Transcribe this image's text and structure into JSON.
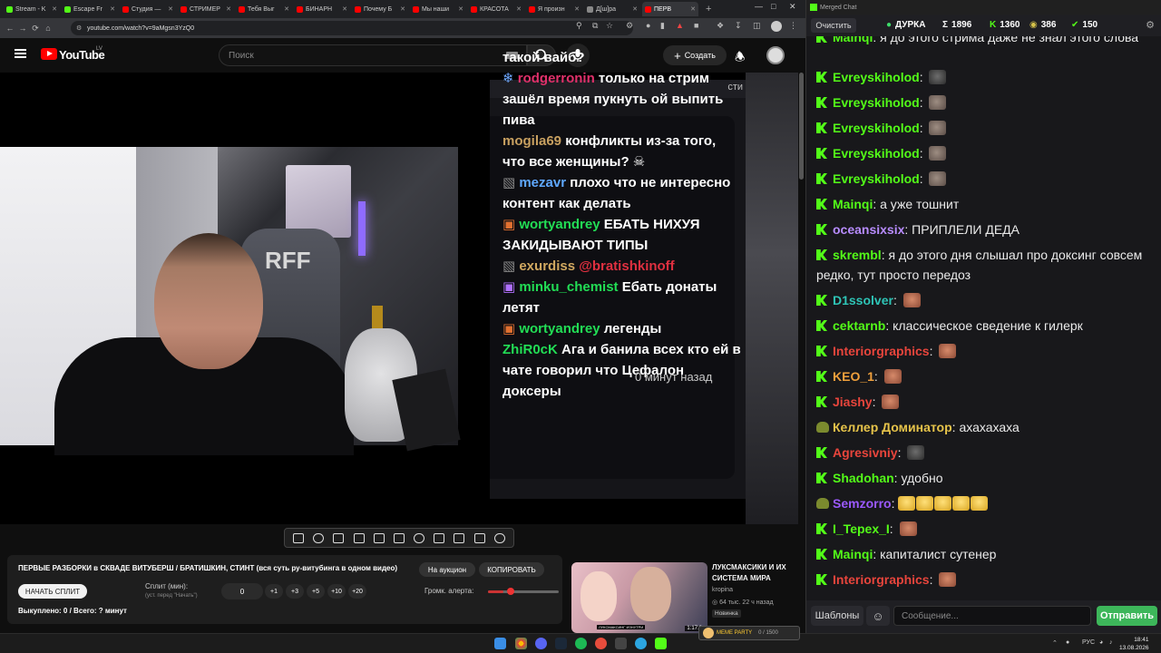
{
  "browser": {
    "tabs": [
      {
        "label": "Stream - K",
        "color": "#53fc18"
      },
      {
        "label": "Escape Fr",
        "color": "#53fc18"
      },
      {
        "label": "Студия —",
        "color": "#ff0000"
      },
      {
        "label": "СТРИМЕР",
        "color": "#ff0000"
      },
      {
        "label": "Тебя Выг",
        "color": "#ff0000"
      },
      {
        "label": "БИНАРН",
        "color": "#ff0000"
      },
      {
        "label": "Почему Б",
        "color": "#ff0000"
      },
      {
        "label": "Мы наши",
        "color": "#ff0000"
      },
      {
        "label": "КРАСОТА",
        "color": "#ff0000"
      },
      {
        "label": "Я произн",
        "color": "#ff0000"
      },
      {
        "label": "Д[ш]ра",
        "color": "#888888"
      },
      {
        "label": "ПЕРВ",
        "color": "#ff0000",
        "active": true
      }
    ],
    "url": "youtube.com/watch?v=9aMgsn3YzQ0"
  },
  "youtube": {
    "logo_word": "YouTube",
    "country_code": "LV",
    "search_placeholder": "Поиск",
    "create_label": "Создать"
  },
  "overlay_chat": {
    "header_fragment": "сти",
    "lines": [
      [
        {
          "t": "такой вайб?",
          "c": "#ffffff"
        }
      ],
      [
        {
          "t": "❄ ",
          "c": "#6ea8ff"
        },
        {
          "t": "rodgerronin",
          "c": "#e0306a"
        },
        {
          "t": " только на стрим",
          "c": "#ffffff"
        }
      ],
      [
        {
          "t": "зашёл время пукнуть ой выпить",
          "c": "#ffffff"
        }
      ],
      [
        {
          "t": "пива",
          "c": "#ffffff"
        }
      ],
      [
        {
          "t": "mogila69",
          "c": "#c8a060"
        },
        {
          "t": " конфликты из-за того,",
          "c": "#ffffff"
        }
      ],
      [
        {
          "t": "что все женщины? ☠",
          "c": "#ffffff"
        }
      ],
      [
        {
          "t": "▧ ",
          "c": "#888888"
        },
        {
          "t": "mezavr",
          "c": "#5fa8ff"
        },
        {
          "t": " плохо что не интересно",
          "c": "#ffffff"
        }
      ],
      [
        {
          "t": "контент как делать",
          "c": "#ffffff"
        }
      ],
      [
        {
          "t": "▣ ",
          "c": "#e07030"
        },
        {
          "t": "wortyandrey",
          "c": "#22dd55"
        },
        {
          "t": " ЕБАТЬ НИХУЯ",
          "c": "#ffffff"
        }
      ],
      [
        {
          "t": "ЗАКИДЫВАЮТ ТИПЫ",
          "c": "#ffffff"
        }
      ],
      [
        {
          "t": "▧ ",
          "c": "#888888"
        },
        {
          "t": "exurdiss",
          "c": "#d0a860"
        },
        {
          "t": " @bratishkinoff",
          "c": "#e03040"
        }
      ],
      [
        {
          "t": "▣ ",
          "c": "#b070ff"
        },
        {
          "t": "minku_chemist",
          "c": "#22dd55"
        },
        {
          "t": " Ебать донаты",
          "c": "#ffffff"
        }
      ],
      [
        {
          "t": "летят",
          "c": "#ffffff"
        }
      ],
      [
        {
          "t": "▣ ",
          "c": "#e07030"
        },
        {
          "t": "wortyandrey",
          "c": "#22dd55"
        },
        {
          "t": " легенды",
          "c": "#ffffff"
        }
      ],
      [
        {
          "t": "ZhiR0cK",
          "c": "#22dd55"
        },
        {
          "t": " Ага и банила всех кто ей в",
          "c": "#ffffff"
        }
      ],
      [
        {
          "t": "чате говорил что Цефалон",
          "c": "#ffffff"
        }
      ],
      [
        {
          "t": "доксеры",
          "c": "#ffffff"
        }
      ]
    ],
    "timestamp": "0 минут назад"
  },
  "extension": {
    "title": "ПЕРВЫЕ РАЗБОРКИ в СКВАДЕ ВИТУБЕРШ / БРАТИШКИН, СТИНТ (вся суть ру-витубинга в одном видео)",
    "auction_label": "На аукцион",
    "copy_label": "КОПИРОВАТЬ",
    "start_split_label": "НАЧАТЬ СПЛИТ",
    "split_label": "Сплит (мин):",
    "split_hint": "(уст. перед \"Начать\")",
    "split_value": "0",
    "increments": [
      "+1",
      "+3",
      "+5",
      "+10",
      "+20"
    ],
    "alert_volume_label": "Громк. алерта:",
    "alert_volume": 0.12,
    "bought_label": "Выкуплено: 0 / Всего: ? минут"
  },
  "recommendation": {
    "title": "ЛУКСМАКСИКИ И ИХ СИСТЕМА МИРА",
    "channel": "kropina",
    "meta": "64 тыс.  22 ч назад",
    "badge": "Новинка",
    "thumb_caption": "ЛУКСМАКСИНГ ИЗНУТРИ",
    "duration": "1:17:2",
    "meme_label": "MEME PARTY",
    "meme_progress": "0 / 1500"
  },
  "chat": {
    "window_title": "Merged Chat",
    "clear_label": "Очистить",
    "stats": [
      {
        "icon": "●",
        "label": "ДУРКА",
        "color": "#3ddc6a"
      },
      {
        "icon": "Σ",
        "label": "1896",
        "color": "#ffffff"
      },
      {
        "icon": "K",
        "label": "1360",
        "color": "#53fc18"
      },
      {
        "icon": "◉",
        "label": "386",
        "color": "#d6c34a"
      },
      {
        "icon": "✔",
        "label": "150",
        "color": "#53fc18"
      }
    ],
    "messages": [
      {
        "nick": "Mainqi",
        "color": "#53fc18",
        "text": "я до этого стрима даже не знал этого слова",
        "badge": "k",
        "emotes": []
      },
      {
        "nick": "Evreyskiholod",
        "color": "#53fc18",
        "text": "",
        "badge": "k",
        "emotes": [
          "frog"
        ]
      },
      {
        "nick": "Evreyskiholod",
        "color": "#53fc18",
        "text": "",
        "badge": "k",
        "emotes": [
          "dog"
        ]
      },
      {
        "nick": "Evreyskiholod",
        "color": "#53fc18",
        "text": "",
        "badge": "k",
        "emotes": [
          "dog"
        ]
      },
      {
        "nick": "Evreyskiholod",
        "color": "#53fc18",
        "text": "",
        "badge": "k",
        "emotes": [
          "dog"
        ]
      },
      {
        "nick": "Evreyskiholod",
        "color": "#53fc18",
        "text": "",
        "badge": "k",
        "emotes": [
          "dog"
        ]
      },
      {
        "nick": "Mainqi",
        "color": "#53fc18",
        "text": "а уже тошнит",
        "badge": "k",
        "emotes": []
      },
      {
        "nick": "oceansixsix",
        "color": "#b88cff",
        "text": "ПРИПЛЕЛИ ДЕДА",
        "badge": "k",
        "emotes": []
      },
      {
        "nick": "skrembl",
        "color": "#53fc18",
        "text": "я до этого дня слышал про доксинг совсем редко, тут просто передоз",
        "badge": "k",
        "emotes": []
      },
      {
        "nick": "D1ssolver",
        "color": "#2ec4b6",
        "text": "",
        "badge": "k",
        "emotes": [
          "face"
        ]
      },
      {
        "nick": "cektarnb",
        "color": "#53fc18",
        "text": "классическое сведение к гилерк",
        "badge": "k",
        "emotes": []
      },
      {
        "nick": "Interiorgraphics",
        "color": "#e8453c",
        "text": "",
        "badge": "k",
        "emotes": [
          "face"
        ]
      },
      {
        "nick": "KEO_1",
        "color": "#f0a03c",
        "text": "",
        "badge": "k",
        "emotes": [
          "face"
        ]
      },
      {
        "nick": "Jiashy",
        "color": "#e8453c",
        "text": "",
        "badge": "k",
        "emotes": [
          "face"
        ]
      },
      {
        "nick": "Келлер Доминатор",
        "color": "#e6c34a",
        "text": "ахахахаха",
        "badge": "pepe",
        "emotes": []
      },
      {
        "nick": "Agresivniy",
        "color": "#e8453c",
        "text": "",
        "badge": "k",
        "emotes": [
          "frog"
        ]
      },
      {
        "nick": "Shadohan",
        "color": "#53fc18",
        "text": "удобно",
        "badge": "k",
        "emotes": []
      },
      {
        "nick": "Semzorro",
        "color": "#9b59ff",
        "text": "",
        "badge": "pepe",
        "emotes": [
          "cry",
          "cry",
          "cry",
          "cry",
          "cry"
        ]
      },
      {
        "nick": "I_Tepex_I",
        "color": "#53fc18",
        "text": "",
        "badge": "k",
        "emotes": [
          "face"
        ]
      },
      {
        "nick": "Mainqi",
        "color": "#53fc18",
        "text": "капиталист сутенер",
        "badge": "k",
        "emotes": []
      },
      {
        "nick": "Interiorgraphics",
        "color": "#e8453c",
        "text": "",
        "badge": "k",
        "emotes": [
          "face"
        ]
      }
    ],
    "templates_label": "Шаблоны",
    "message_placeholder": "Сообщение...",
    "send_label": "Отправить"
  },
  "taskbar": {
    "lang": "РУС",
    "time": "18:41",
    "date": "13.08.2026"
  }
}
